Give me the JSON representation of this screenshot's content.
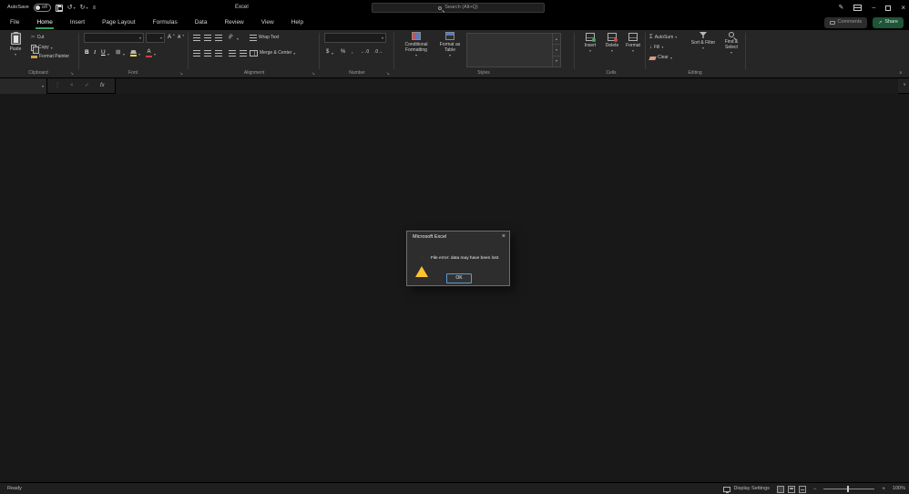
{
  "colors": {
    "accent_green": "#217346",
    "tab_underline": "#35a05f",
    "share_button_bg": "#1e5438",
    "dialog_ok_border": "#5a9bd5",
    "warning_yellow": "#fdc32f"
  },
  "titlebar": {
    "autosave_label": "AutoSave",
    "autosave_state": "Off",
    "app_title": "Excel",
    "search_placeholder": "Search (Alt+Q)"
  },
  "tabs": [
    {
      "label": "File",
      "active": false
    },
    {
      "label": "Home",
      "active": true
    },
    {
      "label": "Insert",
      "active": false
    },
    {
      "label": "Page Layout",
      "active": false
    },
    {
      "label": "Formulas",
      "active": false
    },
    {
      "label": "Data",
      "active": false
    },
    {
      "label": "Review",
      "active": false
    },
    {
      "label": "View",
      "active": false
    },
    {
      "label": "Help",
      "active": false
    }
  ],
  "actions": {
    "comments": "Comments",
    "share": "Share"
  },
  "ribbon": {
    "clipboard": {
      "group": "Clipboard",
      "paste": "Paste",
      "cut": "Cut",
      "copy": "Copy",
      "format_painter": "Format Painter"
    },
    "font": {
      "group": "Font",
      "bold": "B",
      "italic": "I",
      "underline": "U",
      "font_name_value": "",
      "font_size_value": ""
    },
    "alignment": {
      "group": "Alignment",
      "wrap_text": "Wrap Text",
      "merge_center": "Merge & Center"
    },
    "number": {
      "group": "Number",
      "format_value": "",
      "currency": "$",
      "percent": "%",
      "comma": ",",
      "increase_decimal": "←.0",
      "decrease_decimal": ".0→"
    },
    "styles": {
      "group": "Styles",
      "conditional_formatting": "Conditional Formatting",
      "format_as_table": "Format as Table"
    },
    "cells": {
      "group": "Cells",
      "insert": "Insert",
      "delete": "Delete",
      "format": "Format"
    },
    "editing": {
      "group": "Editing",
      "autosum": "AutoSum",
      "fill": "Fill",
      "clear": "Clear",
      "sort_filter": "Sort & Filter",
      "find_select": "Find & Select"
    }
  },
  "formula_bar": {
    "name_box_value": "",
    "formula_value": ""
  },
  "dialog": {
    "title": "Microsoft Excel",
    "message": "File error: data may have been lost.",
    "ok_label": "OK"
  },
  "status_bar": {
    "mode": "Ready",
    "display_settings": "Display Settings",
    "zoom_percent": "100%"
  },
  "icons": {
    "dropdown": "▾",
    "up_small": "▴",
    "undo": "↺",
    "redo": "↻",
    "menu": "≡",
    "pen": "✎",
    "minimize": "–",
    "close": "×",
    "cut": "✂",
    "sum": "Σ",
    "fill_down": "↓",
    "borders": "⊞",
    "fx": "fx",
    "cancel": "×",
    "enter": "✓",
    "dots": "⋮",
    "launcher": "↘",
    "collapse_ribbon": "∧",
    "expand_formula_bar": "∨",
    "zoom_out": "−",
    "zoom_in": "+",
    "grow_font": "A",
    "shrink_font": "A",
    "font_color": "A",
    "orientation": "ab",
    "share_arrow": "↗"
  }
}
